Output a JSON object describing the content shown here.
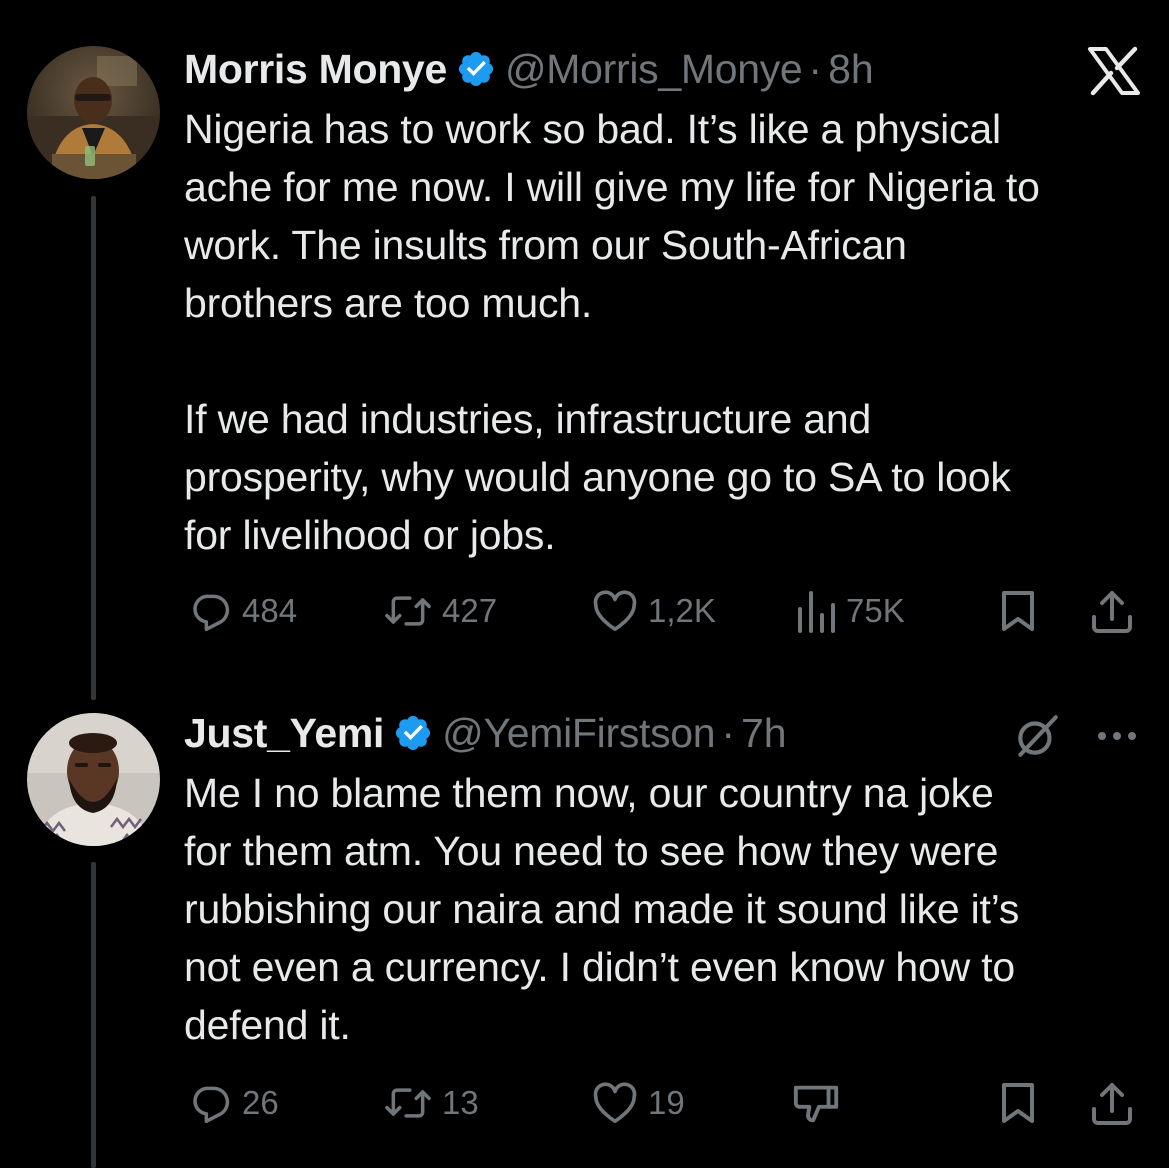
{
  "app": {
    "logo_icon": "x-logo-icon",
    "theme": {
      "background": "#000000",
      "text": "#e7e9ea",
      "muted": "#71767b",
      "verified": "#1d9bf0",
      "thread_line": "#333639"
    }
  },
  "tweets": [
    {
      "display_name": "Morris Monye",
      "verified_icon": "verified-badge-icon",
      "handle": "@Morris_Monye",
      "separator": "·",
      "time": "8h",
      "text": "Nigeria has to work so bad. It’s like a physical\nache for me now. I will give my life for Nigeria to\nwork. The insults from our South-African\nbrothers are too much.\n\nIf we had industries, infrastructure and\nprosperity, why would anyone go to SA to look\nfor livelihood or jobs.",
      "actions": {
        "replies": "484",
        "retweets": "427",
        "likes": "1,2K",
        "views": "75K"
      }
    },
    {
      "display_name": "Just_Yemi",
      "verified_icon": "verified-badge-icon",
      "handle": "@YemiFirstson",
      "separator": "·",
      "time": "7h",
      "text": "Me I no blame them now, our country na joke\nfor them atm. You need to see how they were\nrubbishing our naira and made it sound like it’s\nnot even a currency. I didn’t even know how to\ndefend it.",
      "actions": {
        "replies": "26",
        "retweets": "13",
        "likes": "19"
      }
    }
  ]
}
